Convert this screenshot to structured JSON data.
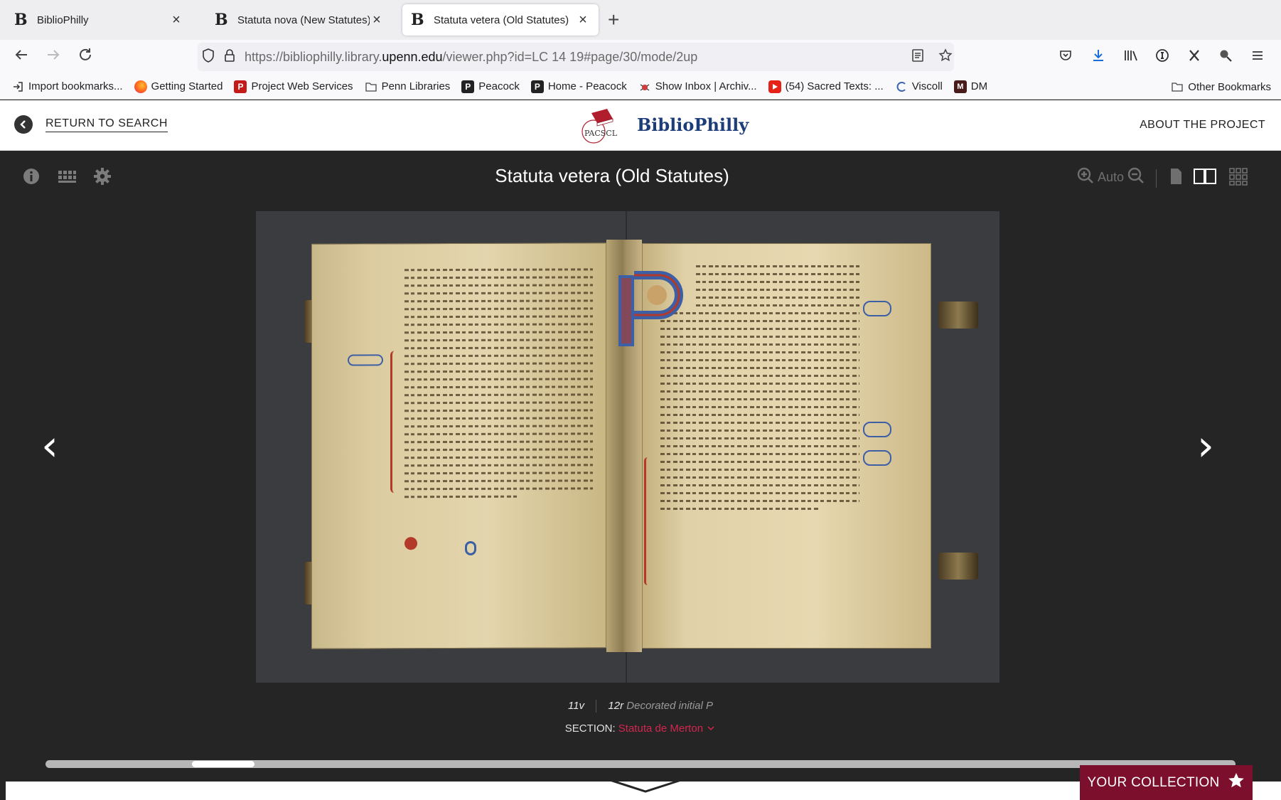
{
  "browser": {
    "tabs": [
      {
        "title": "BiblioPhilly",
        "active": false
      },
      {
        "title": "Statuta nova (New Statutes)",
        "active": false
      },
      {
        "title": "Statuta vetera (Old Statutes)",
        "active": true
      }
    ],
    "favicon_letter": "B",
    "close_glyph": "×",
    "new_tab_glyph": "+",
    "url_prefix": "https://bibliophilly.library.",
    "url_domain": "upenn.edu",
    "url_suffix": "/viewer.php?id=LC 14 19#page/30/mode/2up",
    "bookmarks": [
      {
        "label": "Import bookmarks...",
        "icon": "import-icon"
      },
      {
        "label": "Getting Started",
        "icon": "firefox-icon"
      },
      {
        "label": "Project Web Services",
        "icon": "p-red-icon"
      },
      {
        "label": "Penn Libraries",
        "icon": "folder-icon"
      },
      {
        "label": "Peacock",
        "icon": "p-black-icon"
      },
      {
        "label": "Home - Peacock",
        "icon": "p-black-icon"
      },
      {
        "label": "Show Inbox | Archiv...",
        "icon": "bug-icon"
      },
      {
        "label": "(54) Sacred Texts: ...",
        "icon": "youtube-icon"
      },
      {
        "label": "Viscoll",
        "icon": "viscoll-icon"
      },
      {
        "label": "DM",
        "icon": "dm-icon"
      }
    ],
    "other_bookmarks": "Other Bookmarks"
  },
  "site": {
    "return_label": "RETURN TO SEARCH",
    "logo_text": "BiblioPhilly",
    "logo_badge": "PACSCL",
    "about_label": "ABOUT THE PROJECT"
  },
  "viewer": {
    "title": "Statuta vetera (Old Statutes)",
    "zoom_label": "Auto",
    "left_page": "11v",
    "right_page": "12r",
    "right_page_desc": "Decorated initial P",
    "section_label": "SECTION:",
    "section_value": "Statuta de Merton",
    "scroll_position": 0.13,
    "prev_glyph": "‹",
    "next_glyph": "›"
  },
  "collection": {
    "label": "YOUR COLLECTION",
    "icon": "star-icon"
  },
  "colors": {
    "accent": "#d2264f",
    "collection_bg": "#7c0f2b",
    "brand_blue": "#1c3d78"
  }
}
